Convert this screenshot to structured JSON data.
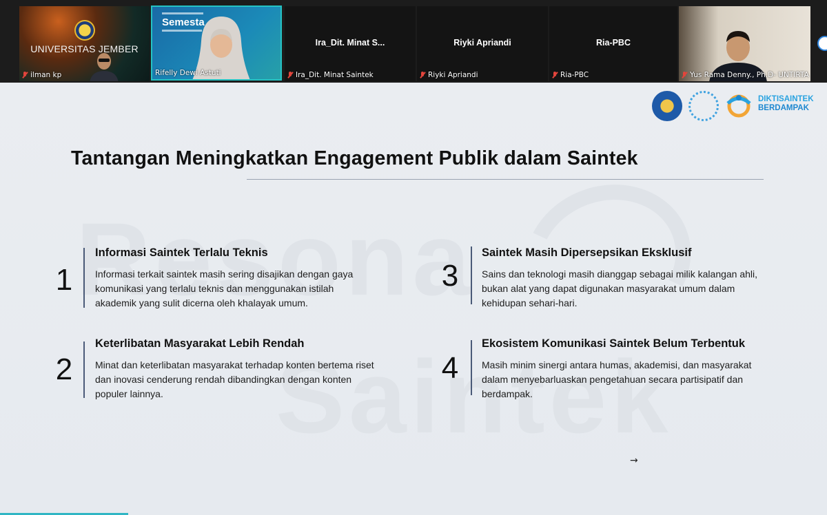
{
  "participants": [
    {
      "name": "ilman kp",
      "tile_text": "UNIVERSITAS JEMBER",
      "muted": true
    },
    {
      "name": "Rifelly Dewi Astuti",
      "tile_text": "Semesta",
      "muted": false
    },
    {
      "name": "Ira_Dit. Minat Saintek",
      "tile_text": "Ira_Dit.  Minat S...",
      "muted": true
    },
    {
      "name": "Riyki Apriandi",
      "tile_text": "Riyki Apriandi",
      "muted": true
    },
    {
      "name": "Ria-PBC",
      "tile_text": "Ria-PBC",
      "muted": true
    },
    {
      "name": "Yus Rama Denny., Ph.D- UNTIRTA",
      "tile_text": "",
      "muted": true
    }
  ],
  "slide": {
    "logo_text_line1": "DIKTISAINTEK",
    "logo_text_line2": "BERDAMPAK",
    "title": "Tantangan Meningkatkan Engagement Publik dalam Saintek",
    "watermark_line1": "Resona",
    "watermark_line2": "Saintek",
    "items": [
      {
        "number": "1",
        "heading": "Informasi Saintek Terlalu Teknis",
        "body": "Informasi terkait saintek masih sering disajikan dengan gaya komunikasi yang terlalu teknis dan menggunakan istilah akademik yang sulit dicerna oleh khalayak umum."
      },
      {
        "number": "2",
        "heading": "Keterlibatan Masyarakat Lebih Rendah",
        "body": "Minat dan keterlibatan masyarakat terhadap konten bertema riset dan inovasi cenderung rendah dibandingkan dengan konten populer lainnya."
      },
      {
        "number": "3",
        "heading": "Saintek Masih Dipersepsikan Eksklusif",
        "body": "Sains dan teknologi masih dianggap sebagai milik kalangan ahli, bukan alat yang dapat digunakan masyarakat umum dalam kehidupan sehari-hari."
      },
      {
        "number": "4",
        "heading": "Ekosistem Komunikasi Saintek Belum Terbentuk",
        "body": "Masih minim sinergi antara humas, akademisi, dan masyarakat dalam menyebarluaskan pengetahuan secara partisipatif dan berdampak."
      }
    ],
    "cursor_glyph": "→"
  }
}
